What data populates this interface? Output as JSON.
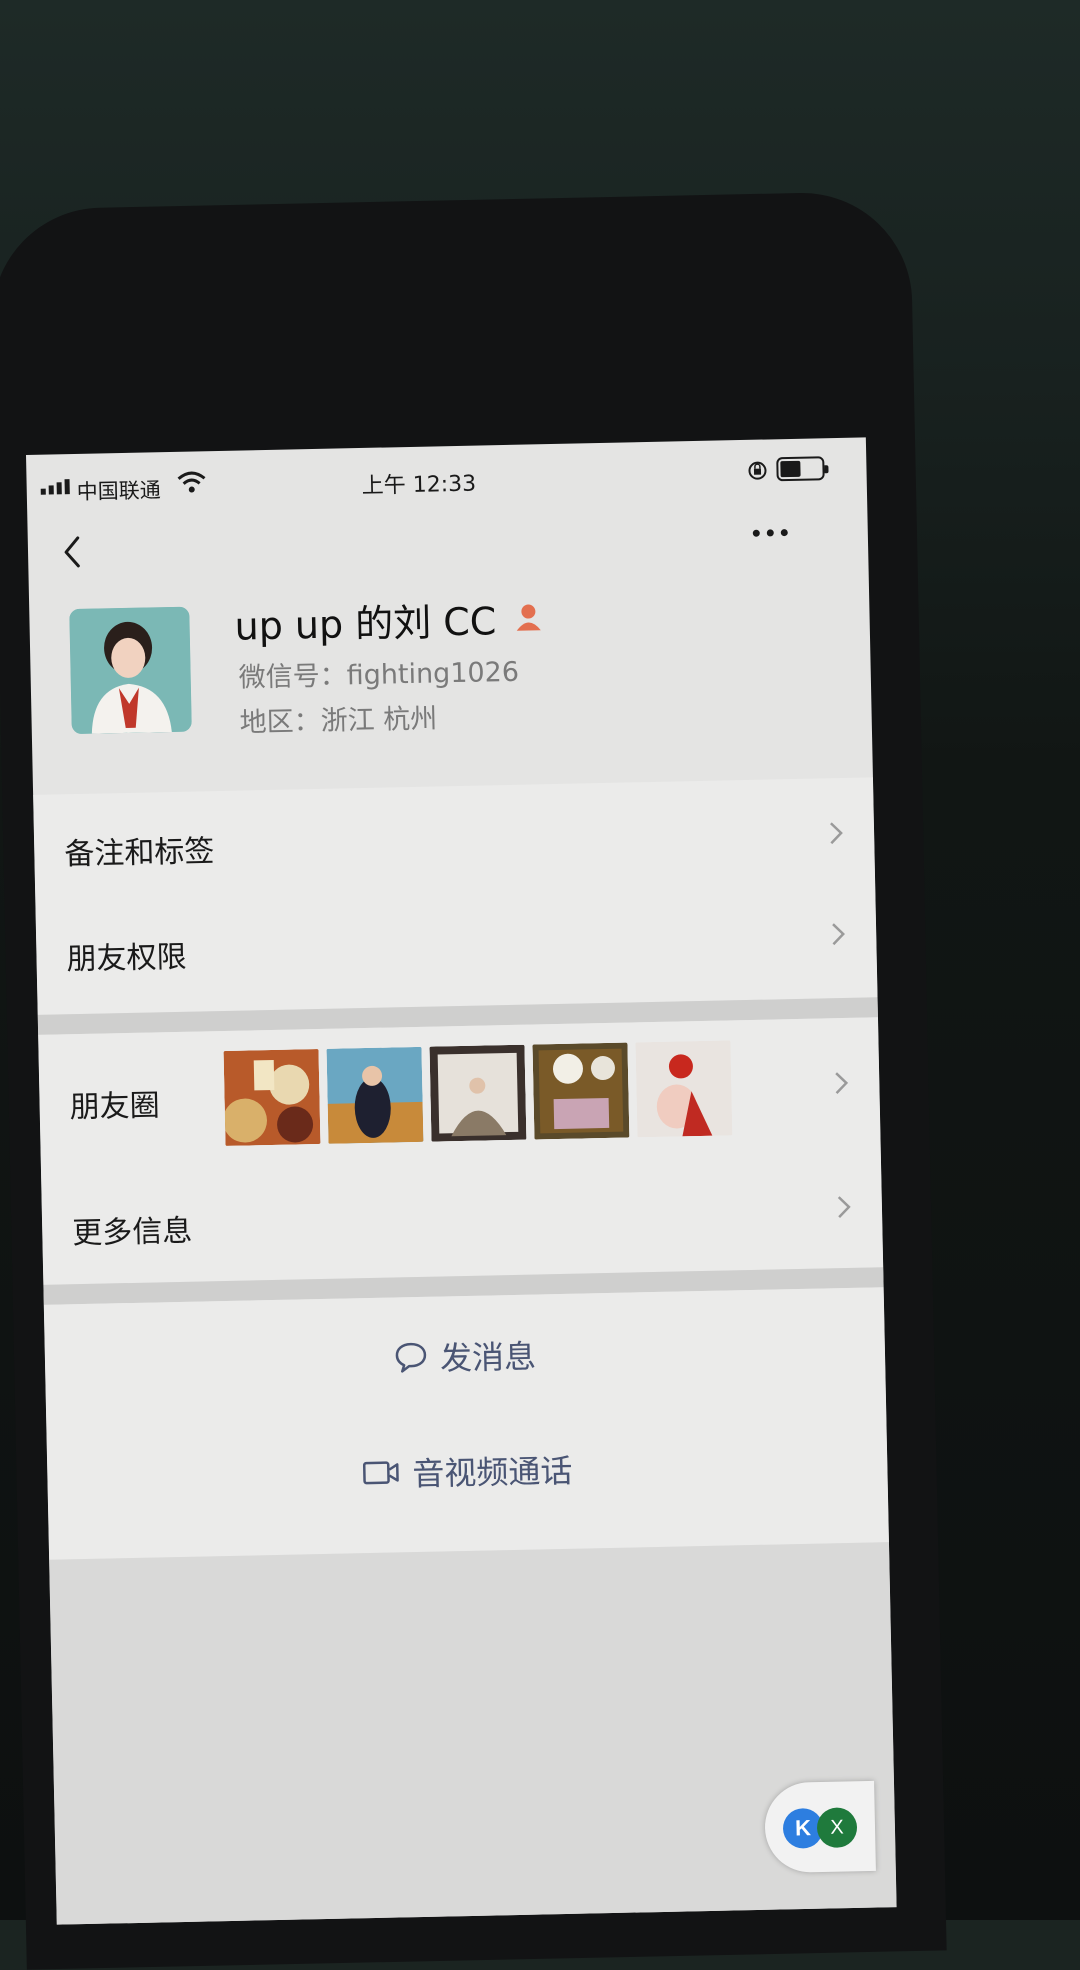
{
  "status_bar": {
    "carrier": "中国联通",
    "time": "上午 12:33"
  },
  "profile": {
    "name": "up up 的刘 CC",
    "wechat_id": "微信号：fighting1026",
    "region": "地区：浙江 杭州"
  },
  "rows": {
    "remark_label": "备注和标签",
    "permissions_label": "朋友权限",
    "moments_label": "朋友圈",
    "more_info_label": "更多信息"
  },
  "actions": {
    "message_label": "发消息",
    "call_label": "音视频通话"
  },
  "floating_widget": {
    "k_label": "K",
    "x_label": "X"
  },
  "colors": {
    "screen_bg": "#e4e4e3",
    "row_bg": "#ebebea",
    "action_text": "#4a5574",
    "badge_orange": "#e36f4f"
  }
}
